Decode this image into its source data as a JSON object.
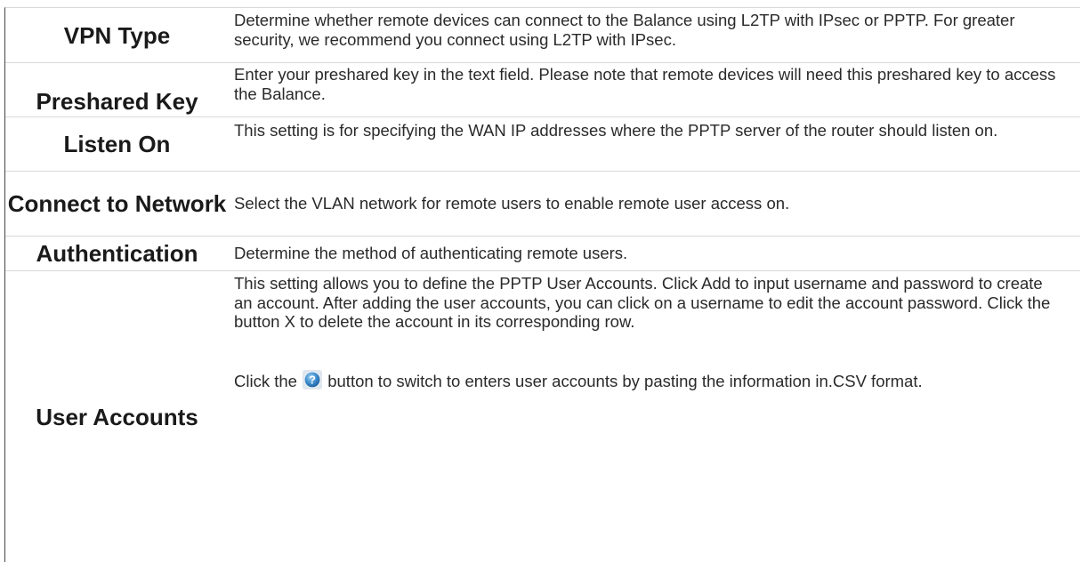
{
  "rows": [
    {
      "label": "VPN Type",
      "description": "Determine whether remote devices can connect to the Balance using L2TP with IPsec or PPTP. For greater security, we recommend you connect using L2TP with IPsec."
    },
    {
      "label": "Preshared Key",
      "description": "Enter your preshared key in the text field. Please note that remote devices will need this preshared key to access the Balance."
    },
    {
      "label": "Listen On",
      "description": "This setting is for specifying the WAN IP addresses where the PPTP server of the router should listen on."
    },
    {
      "label": "Connect to Network",
      "description": "Select the VLAN network for remote users to enable remote user access on."
    },
    {
      "label": "Authentication",
      "description": "Determine the method of authenticating remote users."
    },
    {
      "label": "User Accounts",
      "description": "This setting allows you to define the PPTP User Accounts. Click Add to input username and password to create an account. After adding the user accounts, you can click on a username to edit the account password. Click the button X to delete the account in its corresponding row.",
      "note_before_icon": "Click the",
      "note_icon": "help-question-icon",
      "note_after_icon": "button to switch to enters user accounts by pasting the information in.CSV format."
    }
  ]
}
